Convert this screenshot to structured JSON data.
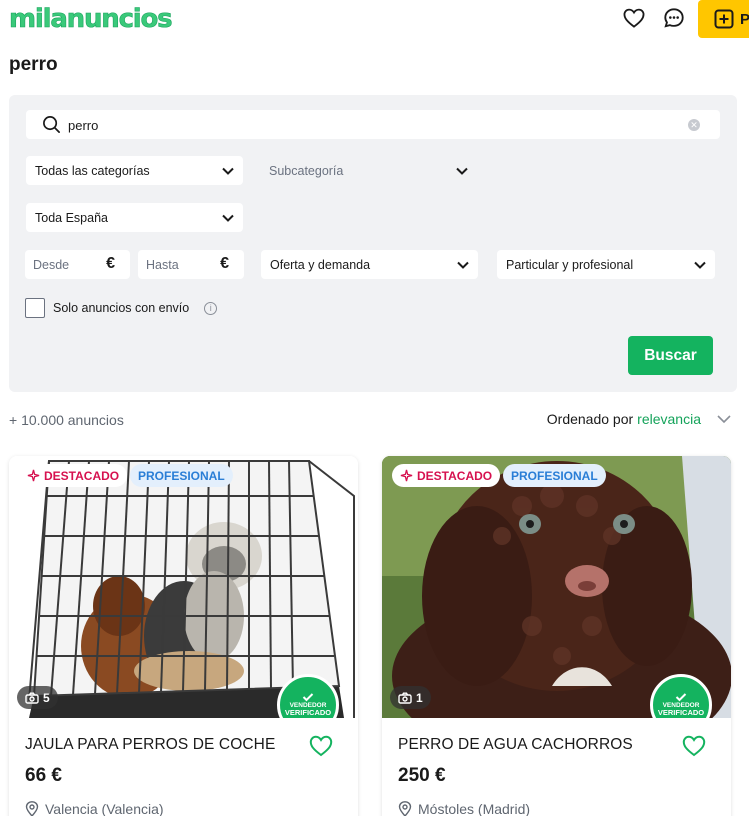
{
  "header": {
    "logo": "milanuncios",
    "publish_label": "P",
    "icons": [
      "heart-icon",
      "chat-icon",
      "plus-square-icon"
    ]
  },
  "page_title": "perro",
  "filters": {
    "search_value": "perro",
    "category": "Todas las categorías",
    "subcategory": "Subcategoría",
    "location": "Toda España",
    "price_from_placeholder": "Desde",
    "price_to_placeholder": "Hasta",
    "currency": "€",
    "offer_type": "Oferta y demanda",
    "seller_type": "Particular y profesional",
    "shipping_only_label": "Solo anuncios con envío",
    "search_button": "Buscar"
  },
  "results": {
    "count_label": "+ 10.000 anuncios",
    "sort_prefix": "Ordenado por",
    "sort_value": "relevancia"
  },
  "listings": [
    {
      "badge_featured": "DESTACADO",
      "badge_pro": "PROFESIONAL",
      "photo_count": "5",
      "title": "JAULA PARA PERROS DE COCHE",
      "price": "66 €",
      "location": "Valencia (Valencia)",
      "seal_line1": "VENDEDOR",
      "seal_line2": "VERIFICADO"
    },
    {
      "badge_featured": "DESTACADO",
      "badge_pro": "PROFESIONAL",
      "photo_count": "1",
      "title": "PERRO DE AGUA CACHORROS",
      "price": "250 €",
      "location": "Móstoles (Madrid)",
      "seal_line1": "VENDEDOR",
      "seal_line2": "VERIFICADO"
    }
  ],
  "colors": {
    "brand_green": "#14b35f",
    "logo_green": "#3ac97a",
    "publish_yellow": "#ffc600",
    "featured_pink": "#d6114f",
    "pro_blue": "#2a7ed6",
    "panel_bg": "#f1f2f4"
  }
}
